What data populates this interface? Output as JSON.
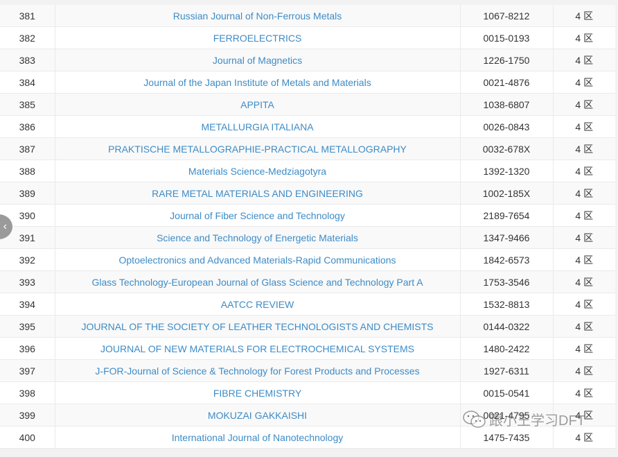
{
  "rows": [
    {
      "no": "381",
      "title": "Russian Journal of Non-Ferrous Metals",
      "issn": "1067-8212",
      "zone": "4 区"
    },
    {
      "no": "382",
      "title": "FERROELECTRICS",
      "issn": "0015-0193",
      "zone": "4 区"
    },
    {
      "no": "383",
      "title": "Journal of Magnetics",
      "issn": "1226-1750",
      "zone": "4 区"
    },
    {
      "no": "384",
      "title": "Journal of the Japan Institute of Metals and Materials",
      "issn": "0021-4876",
      "zone": "4 区"
    },
    {
      "no": "385",
      "title": "APPITA",
      "issn": "1038-6807",
      "zone": "4 区"
    },
    {
      "no": "386",
      "title": "METALLURGIA ITALIANA",
      "issn": "0026-0843",
      "zone": "4 区"
    },
    {
      "no": "387",
      "title": "PRAKTISCHE METALLOGRAPHIE-PRACTICAL METALLOGRAPHY",
      "issn": "0032-678X",
      "zone": "4 区"
    },
    {
      "no": "388",
      "title": "Materials Science-Medziagotyra",
      "issn": "1392-1320",
      "zone": "4 区"
    },
    {
      "no": "389",
      "title": "RARE METAL MATERIALS AND ENGINEERING",
      "issn": "1002-185X",
      "zone": "4 区"
    },
    {
      "no": "390",
      "title": "Journal of Fiber Science and Technology",
      "issn": "2189-7654",
      "zone": "4 区"
    },
    {
      "no": "391",
      "title": "Science and Technology of Energetic Materials",
      "issn": "1347-9466",
      "zone": "4 区"
    },
    {
      "no": "392",
      "title": "Optoelectronics and Advanced Materials-Rapid Communications",
      "issn": "1842-6573",
      "zone": "4 区"
    },
    {
      "no": "393",
      "title": "Glass Technology-European Journal of Glass Science and Technology Part A",
      "issn": "1753-3546",
      "zone": "4 区"
    },
    {
      "no": "394",
      "title": "AATCC REVIEW",
      "issn": "1532-8813",
      "zone": "4 区"
    },
    {
      "no": "395",
      "title": "JOURNAL OF THE SOCIETY OF LEATHER TECHNOLOGISTS AND CHEMISTS",
      "issn": "0144-0322",
      "zone": "4 区"
    },
    {
      "no": "396",
      "title": "JOURNAL OF NEW MATERIALS FOR ELECTROCHEMICAL SYSTEMS",
      "issn": "1480-2422",
      "zone": "4 区"
    },
    {
      "no": "397",
      "title": "J-FOR-Journal of Science & Technology for Forest Products and Processes",
      "issn": "1927-6311",
      "zone": "4 区"
    },
    {
      "no": "398",
      "title": "FIBRE CHEMISTRY",
      "issn": "0015-0541",
      "zone": "4 区"
    },
    {
      "no": "399",
      "title": "MOKUZAI GAKKAISHI",
      "issn": "0021-4795",
      "zone": "4 区"
    },
    {
      "no": "400",
      "title": "International Journal of Nanotechnology",
      "issn": "1475-7435",
      "zone": "4 区"
    }
  ],
  "scroll_button": {
    "icon": "chevron-left-icon",
    "glyph": "‹"
  },
  "watermark": {
    "text": "跟小王学习DFT",
    "icon": "wechat-icon"
  },
  "colors": {
    "link": "#3d8bc6",
    "stripe": "#f9f9f9",
    "border": "#eaeaea"
  }
}
